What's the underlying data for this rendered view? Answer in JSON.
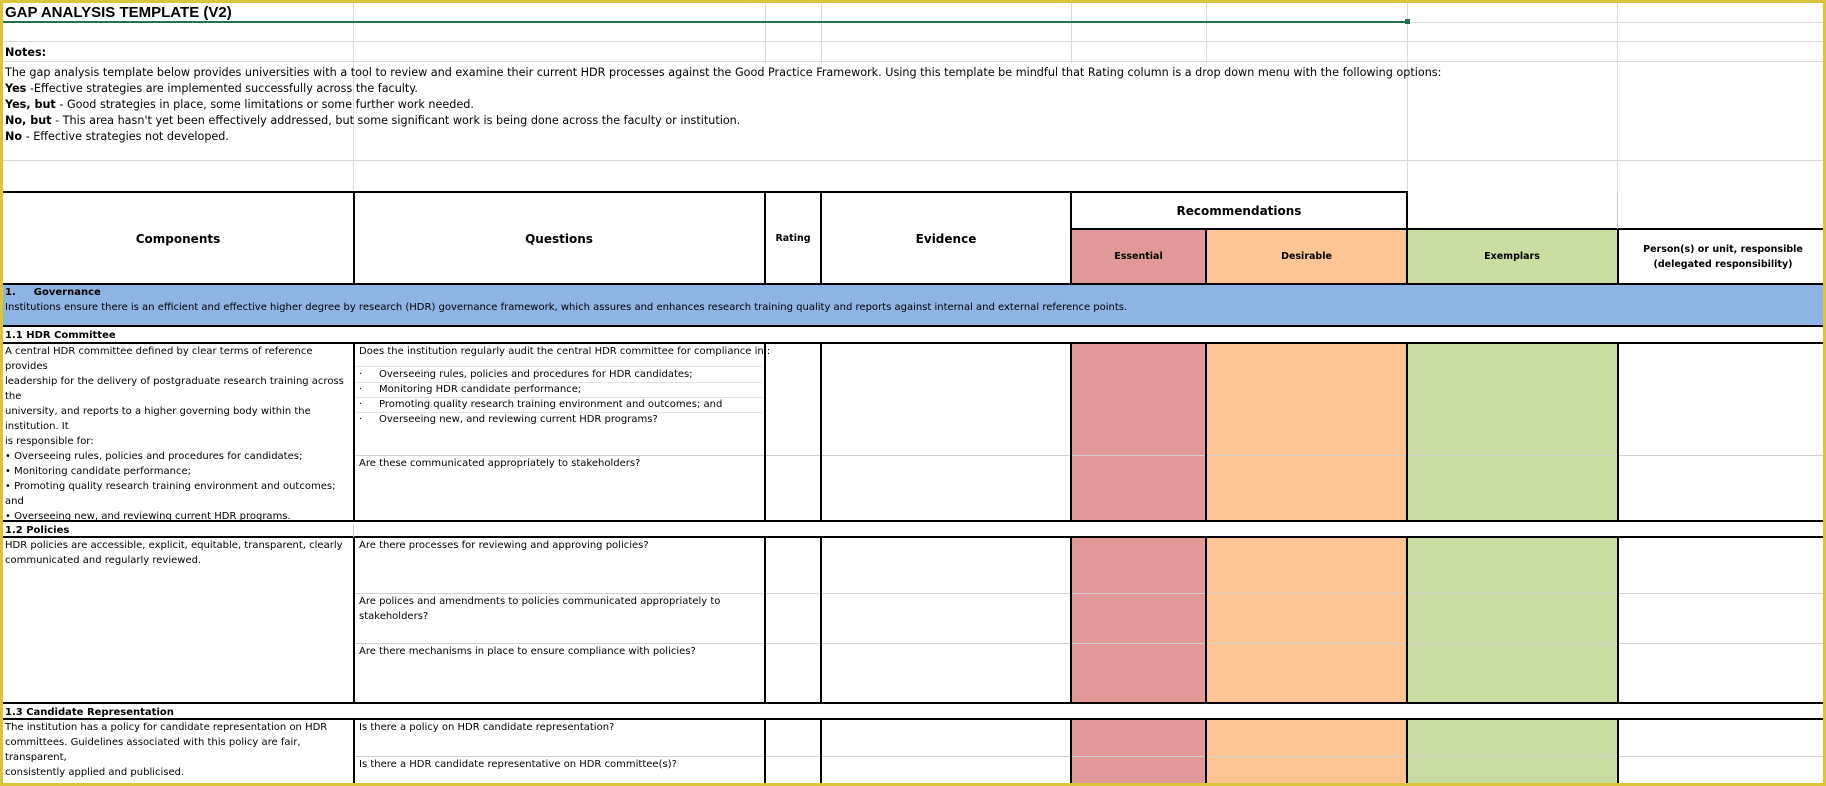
{
  "title": "GAP ANALYSIS TEMPLATE (V2)",
  "notes": {
    "label": "Notes:",
    "intro": "The gap analysis template below provides universities with a tool to review and examine their current HDR processes against the Good Practice Framework. Using this template be mindful that Rating column is a drop down menu with the following options:",
    "options": [
      {
        "key": "Yes",
        "text": " -Effective strategies are implemented successfully across the faculty."
      },
      {
        "key": "Yes, but",
        "text": " - Good strategies in place, some limitations or some further work needed."
      },
      {
        "key": "No, but",
        "text": " - This area hasn't yet been effectively addressed, but some significant work is being done across the faculty or institution."
      },
      {
        "key": "No",
        "text": " - Effective strategies not developed."
      }
    ]
  },
  "headers": {
    "components": "Components",
    "questions": "Questions",
    "rating": "Rating",
    "evidence": "Evidence",
    "recommendations": "Recommendations",
    "essential": "Essential",
    "desirable": "Desirable",
    "exemplars": "Exemplars",
    "responsible": "Person(s) or unit, responsible (delegated responsibility)"
  },
  "colors": {
    "governance_band": "#8db4e2",
    "essential": "#e09898",
    "desirable": "#fcc593",
    "exemplars": "#c9dca1",
    "frame": "#d9c43a"
  },
  "section1": {
    "number": "1.",
    "title": "Governance",
    "description": "Institutions ensure there is an efficient and effective higher degree by research (HDR) governance framework, which assures and enhances research training quality and reports against internal and external reference points."
  },
  "s11": {
    "title": "1.1 HDR Committee",
    "component_lines": [
      "A central HDR committee defined by clear terms of reference provides",
      "leadership for the delivery of postgraduate research training across the",
      "university, and reports to a higher governing body within the institution. It",
      "is responsible for:",
      "• Overseeing rules, policies and procedures for candidates;",
      "• Monitoring candidate performance;",
      "• Promoting quality research training environment and outcomes; and",
      "• Overseeing new, and reviewing current HDR programs."
    ],
    "q1": "Does the institution regularly audit  the central HDR committee for compliance in :",
    "q1_bullets": [
      "Overseeing rules, policies and procedures for HDR candidates;",
      "Monitoring HDR candidate performance;",
      "Promoting quality research training environment and outcomes; and",
      "Overseeing new, and reviewing current HDR programs?"
    ],
    "bullet_mark": "·",
    "q2": "Are these communicated appropriately to stakeholders?"
  },
  "s12": {
    "title": "1.2  Policies",
    "component_lines": [
      "HDR policies are accessible, explicit, equitable, transparent, clearly",
      "communicated and regularly reviewed."
    ],
    "q1": "Are there processes for reviewing and approving policies?",
    "q2_lines": [
      "Are polices and amendments to policies communicated appropriately to",
      "stakeholders?"
    ],
    "q3": "Are there mechanisms in place to ensure compliance with policies?"
  },
  "s13": {
    "title": "1.3  Candidate Representation",
    "component_lines": [
      "The institution has a policy for candidate representation on HDR",
      "committees. Guidelines associated with this policy are fair, transparent,",
      "consistently applied and publicised."
    ],
    "q1": "Is there a policy on HDR candidate representation?",
    "q2": "Is there a HDR candidate representative on HDR committee(s)?"
  }
}
